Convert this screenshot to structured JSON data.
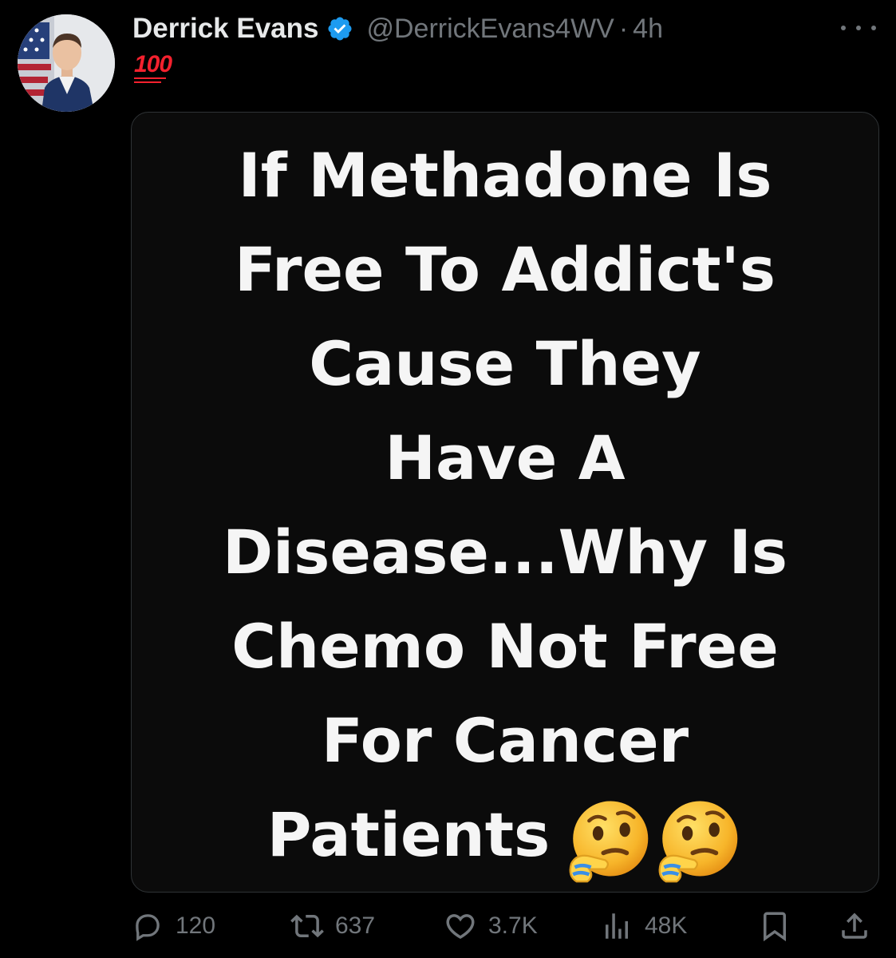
{
  "author": {
    "name": "Derrick Evans",
    "handle": "@DerrickEvans4WV",
    "separator": "·",
    "time": "4h",
    "verified": true
  },
  "tweet": {
    "text": "100",
    "emoji_name": "hundred-points-emoji"
  },
  "media": {
    "lines": [
      "If Methadone Is",
      "Free To Addict's",
      "Cause They",
      "Have A",
      "Disease...Why Is",
      "Chemo Not Free",
      "For Cancer",
      "Patients"
    ],
    "trailing_emojis": [
      "thinking-face-emoji",
      "thinking-face-emoji"
    ]
  },
  "actions": {
    "replies": "120",
    "reposts": "637",
    "likes": "3.7K",
    "views": "48K"
  },
  "colors": {
    "background": "#000000",
    "text_primary": "#e7e9ea",
    "text_secondary": "#71767b",
    "verified_blue": "#1d9bf0",
    "hundred_red": "#f4212e"
  }
}
